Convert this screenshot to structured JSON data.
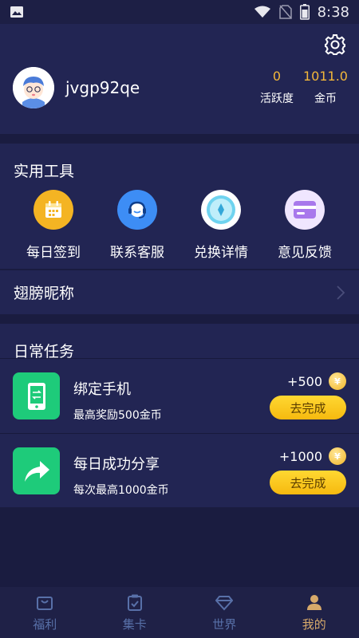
{
  "status_bar": {
    "time": "8:38",
    "icons": [
      "image-icon",
      "wifi-icon",
      "no-sim-icon",
      "battery-icon"
    ]
  },
  "profile": {
    "username": "jvgp92qe",
    "settings_icon": "gear-icon",
    "stats": [
      {
        "value": "0",
        "label": "活跃度"
      },
      {
        "value": "1011.0",
        "label": "金币"
      }
    ]
  },
  "tools": {
    "title": "实用工具",
    "items": [
      {
        "label": "每日签到",
        "icon": "calendar-icon",
        "color": "#f4b423"
      },
      {
        "label": "联系客服",
        "icon": "headset-icon",
        "color": "#3d8df5"
      },
      {
        "label": "兑换详情",
        "icon": "diamond-icon",
        "color": "#ffffff"
      },
      {
        "label": "意见反馈",
        "icon": "card-icon",
        "color": "#f0e6ff"
      }
    ]
  },
  "nickname": {
    "label": "翅膀昵称"
  },
  "tasks": {
    "title": "日常任务",
    "items": [
      {
        "title": "绑定手机",
        "desc": "最高奖励500金币",
        "reward": "+500",
        "button": "去完成",
        "icon": "phone-icon"
      },
      {
        "title": "每日成功分享",
        "desc": "每次最高1000金币",
        "reward": "+1000",
        "button": "去完成",
        "icon": "share-arrow-icon"
      }
    ],
    "coin_symbol": "¥"
  },
  "bottom_nav": {
    "items": [
      {
        "label": "福利",
        "icon": "bag-icon",
        "active": false
      },
      {
        "label": "集卡",
        "icon": "clipboard-icon",
        "active": false
      },
      {
        "label": "世界",
        "icon": "diamond-icon",
        "active": false
      },
      {
        "label": "我的",
        "icon": "person-icon",
        "active": true
      }
    ]
  },
  "colors": {
    "background": "#1a1c40",
    "card": "#222553",
    "accent_gold": "#f3b73a",
    "task_green": "#1ecb7a",
    "button_yellow": "#ffd832",
    "nav_inactive": "#5870a8",
    "nav_active": "#d7a96a"
  }
}
